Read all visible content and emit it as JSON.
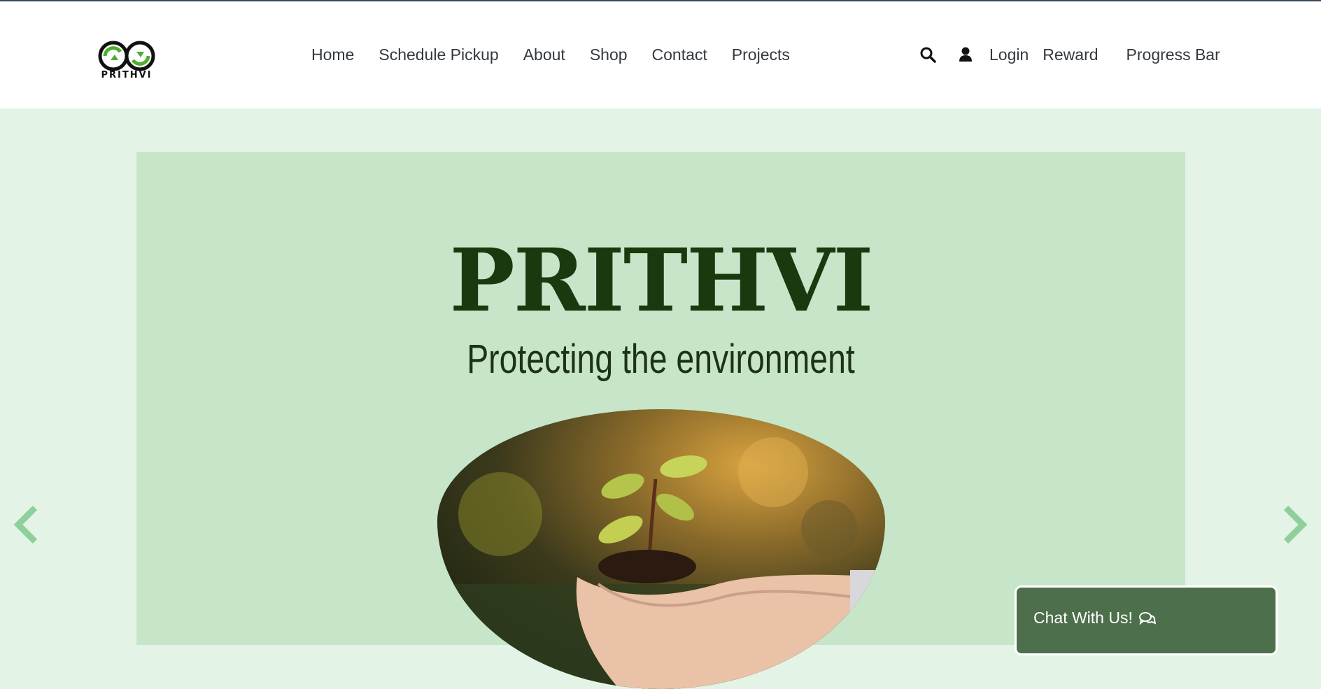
{
  "brand": {
    "logo_text": "PRITHVI"
  },
  "nav": {
    "links": [
      "Home",
      "Schedule Pickup",
      "About",
      "Shop",
      "Contact",
      "Projects"
    ],
    "login": "Login",
    "reward": "Reward",
    "progress": "Progress Bar"
  },
  "hero": {
    "title": "PRITHVI",
    "subtitle": "Protecting the environment"
  },
  "chat": {
    "label": "Chat With Us!"
  },
  "icons": {
    "search": "search-icon",
    "user": "user-icon",
    "prev": "chevron-left-icon",
    "next": "chevron-right-icon",
    "chat": "comments-icon"
  },
  "colors": {
    "page_bg": "#e3f4e7",
    "hero_bg": "#c7e5c8",
    "title": "#193a0f",
    "chat_bg": "#4e6f4b",
    "arrow": "#8fcf9c"
  }
}
